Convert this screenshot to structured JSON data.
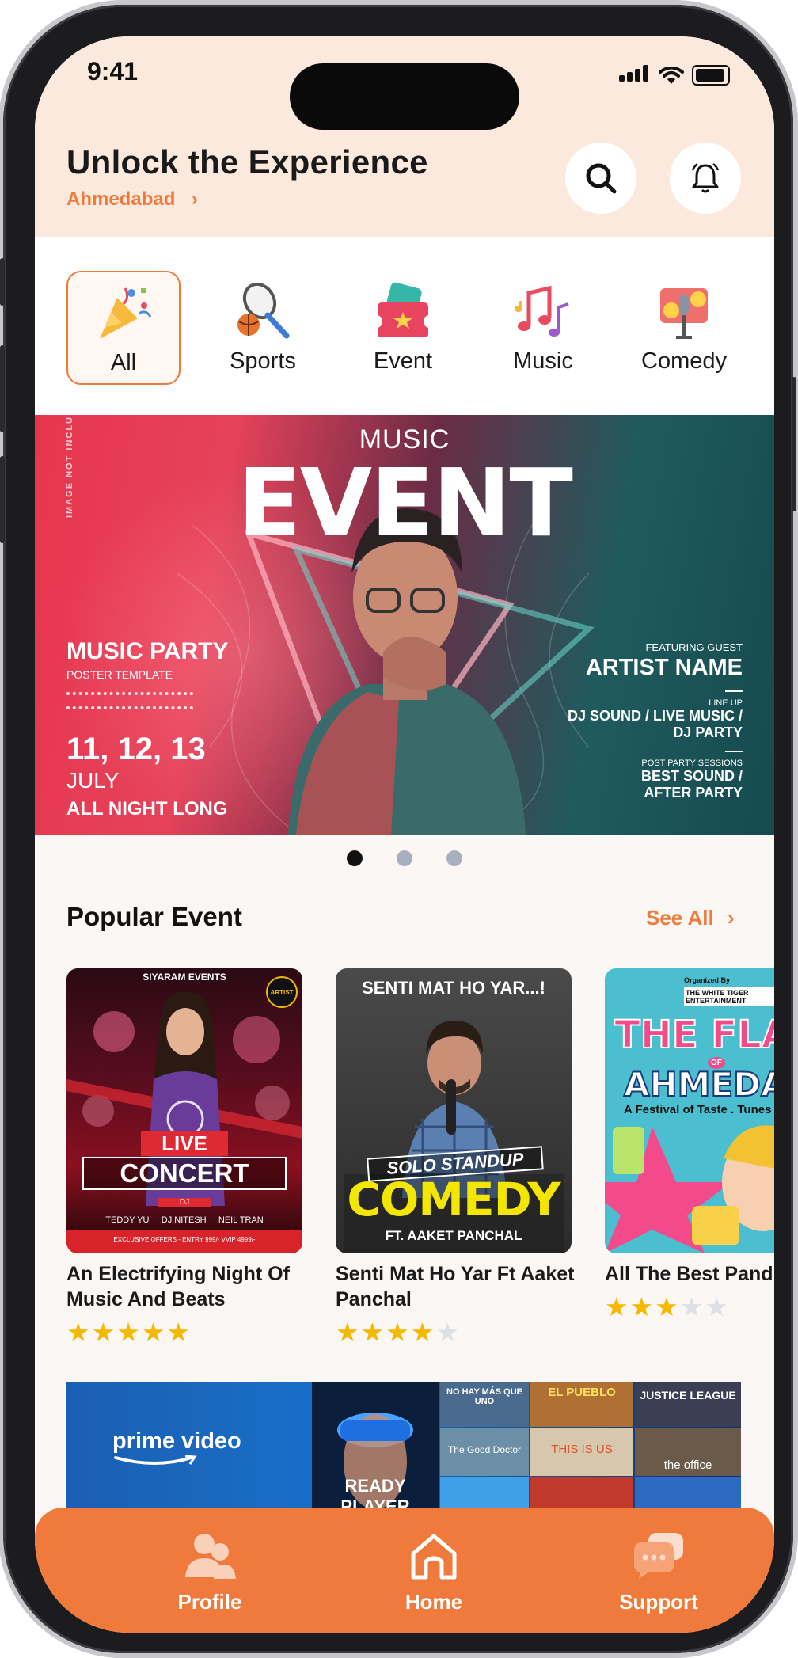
{
  "status": {
    "time": "9:41"
  },
  "header": {
    "title": "Unlock the Experience",
    "location": "Ahmedabad"
  },
  "categories": [
    {
      "label": "All",
      "icon": "party-popper-icon",
      "active": true
    },
    {
      "label": "Sports",
      "icon": "tennis-racket-icon"
    },
    {
      "label": "Event",
      "icon": "ticket-icon"
    },
    {
      "label": "Music",
      "icon": "music-notes-icon"
    },
    {
      "label": "Comedy",
      "icon": "comedy-mic-icon"
    }
  ],
  "banner": {
    "side_text": "IMAGE NOT INCLU",
    "kicker": "MUSIC",
    "headline": "EVENT",
    "party_title": "MUSIC PARTY",
    "party_sub": "POSTER TEMPLATE",
    "dates": "11, 12, 13",
    "month": "JULY",
    "tagline": "ALL NIGHT LONG",
    "featuring": "FEATURING GUEST",
    "artist": "ARTIST NAME",
    "lineup_label": "LINE UP",
    "lineup": "DJ SOUND / LIVE MUSIC /",
    "lineup2": "DJ PARTY",
    "post_label": "POST PARTY SESSIONS",
    "post": "BEST SOUND /",
    "post2": "AFTER PARTY",
    "slides": 3,
    "active_slide": 1
  },
  "popular": {
    "title": "Popular Event",
    "see_all": "See All",
    "events": [
      {
        "name": "An Electrifying Night Of Music And Beats",
        "rating": 5,
        "poster": {
          "top": "SIYARAM EVENTS",
          "badge": "ARTIST",
          "l1": "LIVE",
          "l2": "CONCERT",
          "tag": "DJ",
          "names": "TEDDY YU     DJ NITESH     NEIL TRAN",
          "offer": "EXCLUSIVE OFFERS - ENTRY 999/- VVIP 4999/-"
        }
      },
      {
        "name": "Senti Mat Ho Yar Ft Aaket Panchal",
        "rating": 4,
        "poster": {
          "top": "SENTI MAT HO YAR...!",
          "l1": "SOLO STANDUP",
          "l2": "COMEDY",
          "ft": "FT. AAKET PANCHAL"
        }
      },
      {
        "name": "All The Best Pand",
        "rating": 3,
        "poster": {
          "org": "Organized By",
          "org2": "THE WHITE TIGER ENTERTAINMENT",
          "l1": "THE FLAVO",
          "of": "OF",
          "l2": "AHMEDAB",
          "sub": "A Festival of Taste . Tunes"
        }
      }
    ]
  },
  "promo": {
    "brand": "prime video",
    "tiles": [
      "NO HAY MÁS QUE UNO",
      "EL PUEBLO",
      "JUSTICE LEAGUE",
      "The Good Doctor",
      "THIS IS US",
      "the office",
      "READY PLAYER"
    ]
  },
  "nav": [
    {
      "label": "Profile",
      "icon": "profile-icon"
    },
    {
      "label": "Home",
      "icon": "home-icon"
    },
    {
      "label": "Support",
      "icon": "chat-bubbles-icon"
    }
  ],
  "colors": {
    "accent": "#f07a3b",
    "header_bg": "#fbe9dd",
    "star": "#f5b800"
  }
}
